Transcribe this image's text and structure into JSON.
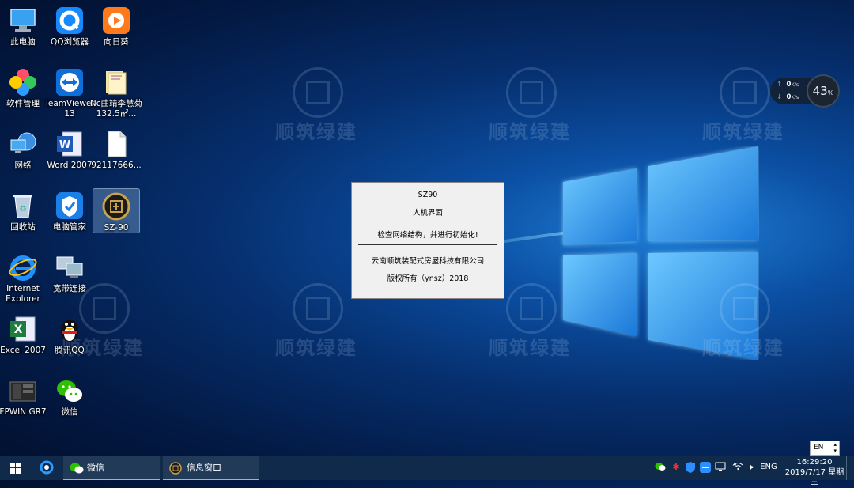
{
  "desktop": {
    "icons": [
      {
        "label": "此电脑"
      },
      {
        "label": "QQ浏览器"
      },
      {
        "label": "向日葵"
      },
      {
        "label": "软件管理"
      },
      {
        "label": "TeamViewer 13"
      },
      {
        "label": "Nc曲靖李慧菊132.5㎡..."
      },
      {
        "label": "网络"
      },
      {
        "label": "Word 2007"
      },
      {
        "label": "92117666..."
      },
      {
        "label": "回收站"
      },
      {
        "label": "电脑管家"
      },
      {
        "label": "SZ-90"
      },
      {
        "label": "Internet Explorer"
      },
      {
        "label": "宽带连接"
      },
      {
        "label": "Excel 2007"
      },
      {
        "label": "腾讯QQ"
      },
      {
        "label": "FPWIN GR7"
      },
      {
        "label": "微信"
      }
    ],
    "watermark_text": "顺筑绿建"
  },
  "network_widget": {
    "upload": "0",
    "download": "0",
    "unit": "K/s",
    "cpu_percent": "43"
  },
  "dialog": {
    "title": "SZ90",
    "subtitle": "人机界面",
    "message": "检查网络结构，并进行初始化!",
    "company": "云南顺筑装配式房屋科技有限公司",
    "copyright": "版权所有（ynsz）2018"
  },
  "ime_indicator": "EN",
  "taskbar": {
    "items": [
      {
        "label": "微信"
      },
      {
        "label": "信息窗口"
      }
    ],
    "lang": "ENG",
    "time": "16:29:20",
    "date": "2019/7/17 星期三"
  },
  "colors": {
    "taskbar_bg": "#0f2a4a",
    "dialog_bg": "#f0f0f0",
    "accent": "#8ab8e6"
  }
}
